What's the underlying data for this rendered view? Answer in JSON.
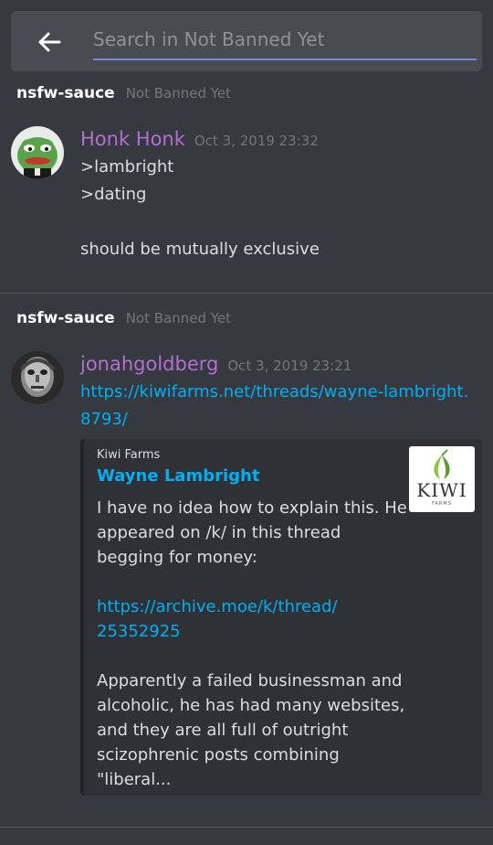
{
  "search": {
    "placeholder": "Search in Not Banned Yet"
  },
  "results": [
    {
      "channel": "nsfw-sauce",
      "guild": "Not Banned Yet",
      "author": "Honk Honk",
      "timestamp": "Oct 3, 2019 23:32",
      "lines": [
        ">lambright",
        ">dating",
        "",
        "should be mutually exclusive"
      ]
    },
    {
      "channel": "nsfw-sauce",
      "guild": "Not Banned Yet",
      "author": "jonahgoldberg",
      "timestamp": "Oct 3, 2019 23:21",
      "link_line1": "https://kiwifarms.net/threads/wayne-lambright.",
      "link_line2": "8793/",
      "embed": {
        "provider": "Kiwi Farms",
        "title": "Wayne Lambright",
        "desc1": "I have no idea how to explain this.  He",
        "desc2": "appeared on /k/ in this thread",
        "desc3": "begging for money:",
        "link1": "https://archive.moe/k/thread/",
        "link2": "25352925",
        "desc4": "Apparently a failed businessman and",
        "desc5": "alcoholic, he has had many websites,",
        "desc6": "and they are all full of outright",
        "desc7": "scizophrenic posts combining",
        "desc8": "\"liberal...",
        "thumb_word": "KIWI",
        "thumb_sub": "FARMS"
      }
    }
  ],
  "colors": {
    "background": "#36393f",
    "accent": "#7289da",
    "link": "#00b0f4",
    "author": "#b36fd1"
  }
}
